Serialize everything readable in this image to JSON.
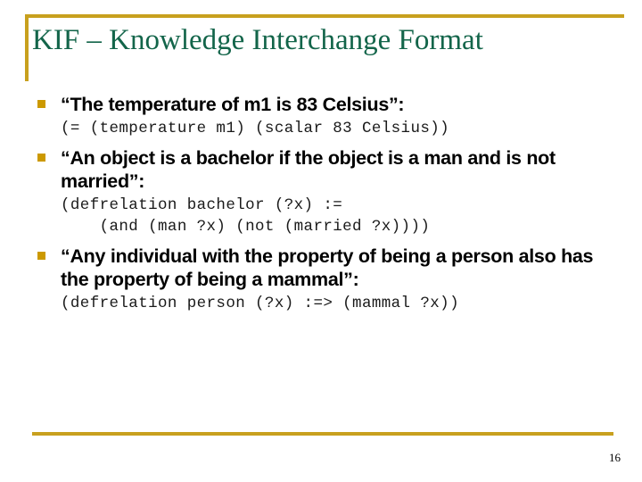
{
  "slide": {
    "title": "KIF – Knowledge Interchange Format",
    "page_number": "16",
    "accent_color": "#c8a01e",
    "title_color": "#13654a",
    "bullet_color": "#cc9900",
    "background_color": "#ffffff"
  },
  "bullets": [
    {
      "text": "“The temperature of m1 is 83 Celsius”:",
      "code": [
        "(= (temperature m1) (scalar 83 Celsius))"
      ]
    },
    {
      "text": "“An object is a bachelor if the object is a man and is not married”:",
      "code": [
        "(defrelation bachelor (?x) :=",
        "    (and (man ?x) (not (married ?x))))"
      ]
    },
    {
      "text": "“Any individual with the property of being a person also has the property of being a mammal”:",
      "code": [
        "(defrelation person (?x) :=> (mammal ?x))"
      ]
    }
  ]
}
